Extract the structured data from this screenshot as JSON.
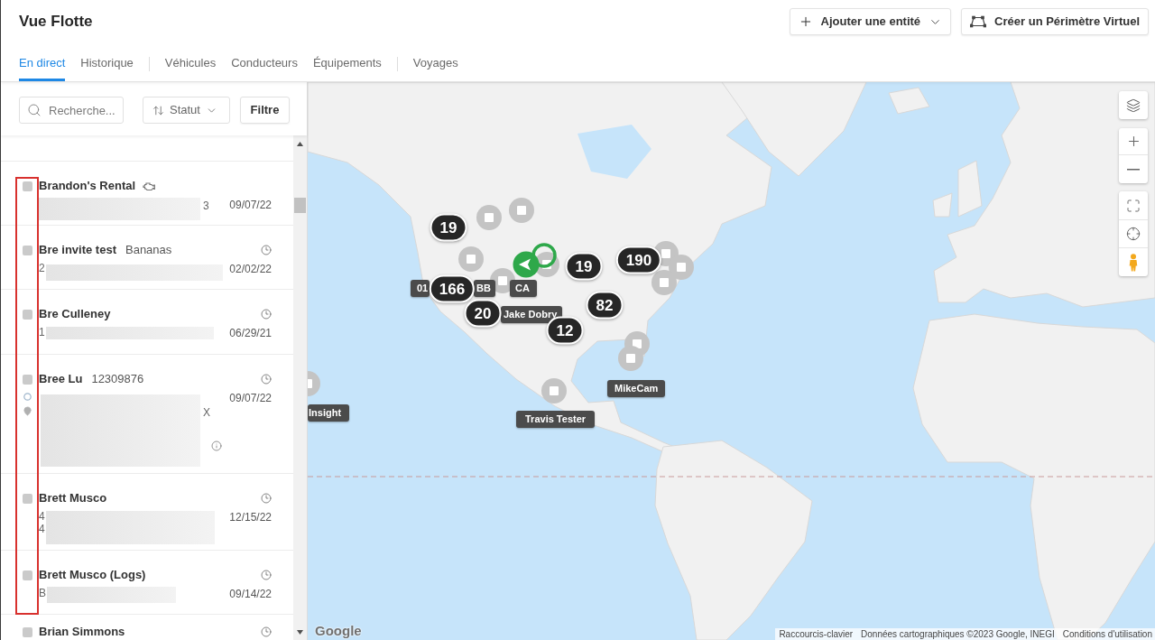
{
  "header": {
    "title": "Vue Flotte",
    "buttons": [
      {
        "label": "Ajouter une entité",
        "kind": "add"
      },
      {
        "label": "Créer un Périmètre Virtuel",
        "kind": "geofence"
      }
    ]
  },
  "tab_groups": [
    {
      "tabs": [
        {
          "label": "En direct",
          "selected": true
        },
        {
          "label": "Historique",
          "selected": false
        }
      ]
    },
    {
      "tabs": [
        {
          "label": "Véhicules",
          "selected": false
        },
        {
          "label": "Conducteurs",
          "selected": false
        },
        {
          "label": "Équipements",
          "selected": false
        }
      ]
    },
    {
      "tabs": [
        {
          "label": "Voyages",
          "selected": false
        }
      ]
    }
  ],
  "sidebar": {
    "search": {
      "placeholder": "Recherche..."
    },
    "sort": {
      "label": "Statut"
    },
    "filter_button": {
      "label": "Filtre"
    },
    "rows": [
      {
        "name": "Brandon's Rental",
        "kind": "engine",
        "checked": false,
        "address_end": [
          "3"
        ],
        "date": "09/07/22"
      },
      {
        "name": "Bre invite test",
        "tag": "Bananas",
        "kind": "clock",
        "checked": false,
        "address_start": [
          "2"
        ],
        "date": "02/02/22"
      },
      {
        "name": "Bre Culleney",
        "kind": "clock",
        "checked": false,
        "address_start": [
          "1"
        ],
        "date": "06/29/21"
      },
      {
        "name": "Bree Lu",
        "tag": "12309876",
        "kind": "trip",
        "checked": false,
        "address_end": [
          "X"
        ],
        "date": "09/07/22"
      },
      {
        "name": "Brett Musco",
        "kind": "clock",
        "checked": false,
        "address_start": [
          "4",
          "4"
        ],
        "date": "12/15/22"
      },
      {
        "name": "Brett Musco (Logs)",
        "kind": "clock",
        "checked": false,
        "address_start": [
          "B"
        ],
        "date": "09/14/22"
      },
      {
        "name": "Brian Simmons",
        "kind": "clock",
        "checked": false
      }
    ]
  },
  "map": {
    "clusters": [
      "19",
      "166",
      "20",
      "12",
      "82",
      "19",
      "190"
    ],
    "vehicle_labels": [
      "01",
      "BB",
      "CA",
      "Jake Dobry",
      "MikeCam",
      "Travis Tester",
      "Insight"
    ],
    "logo": "Google",
    "attribution": [
      "Raccourcis-clavier",
      "Données cartographiques ©2023 Google, INEGI",
      "Conditions d'utilisation"
    ]
  }
}
